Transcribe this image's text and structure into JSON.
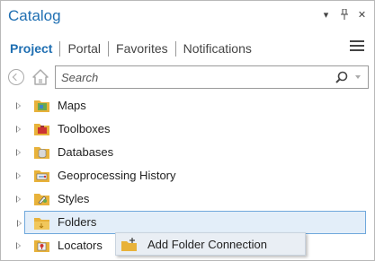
{
  "pane": {
    "title": "Catalog"
  },
  "window_controls": {
    "options_glyph": "▾",
    "pin_glyph": "📌",
    "close_glyph": "✕"
  },
  "tabs": [
    {
      "label": "Project",
      "active": true
    },
    {
      "label": "Portal",
      "active": false
    },
    {
      "label": "Favorites",
      "active": false
    },
    {
      "label": "Notifications",
      "active": false
    }
  ],
  "search": {
    "placeholder": "Search",
    "value": ""
  },
  "tree": [
    {
      "label": "Maps",
      "icon": "maps-folder-icon"
    },
    {
      "label": "Toolboxes",
      "icon": "toolboxes-folder-icon"
    },
    {
      "label": "Databases",
      "icon": "databases-folder-icon"
    },
    {
      "label": "Geoprocessing History",
      "icon": "geoprocessing-history-icon"
    },
    {
      "label": "Styles",
      "icon": "styles-folder-icon"
    },
    {
      "label": "Folders",
      "icon": "folders-icon",
      "selected": true
    },
    {
      "label": "Locators",
      "icon": "locators-folder-icon"
    }
  ],
  "context_menu": {
    "items": [
      {
        "label": "Add Folder Connection",
        "icon": "add-folder-connection-icon"
      }
    ]
  },
  "colors": {
    "accent": "#1f6fb2",
    "selection_bg": "#e3eef9",
    "selection_border": "#6fa8dc",
    "folder_yellow": "#e8b23a"
  }
}
